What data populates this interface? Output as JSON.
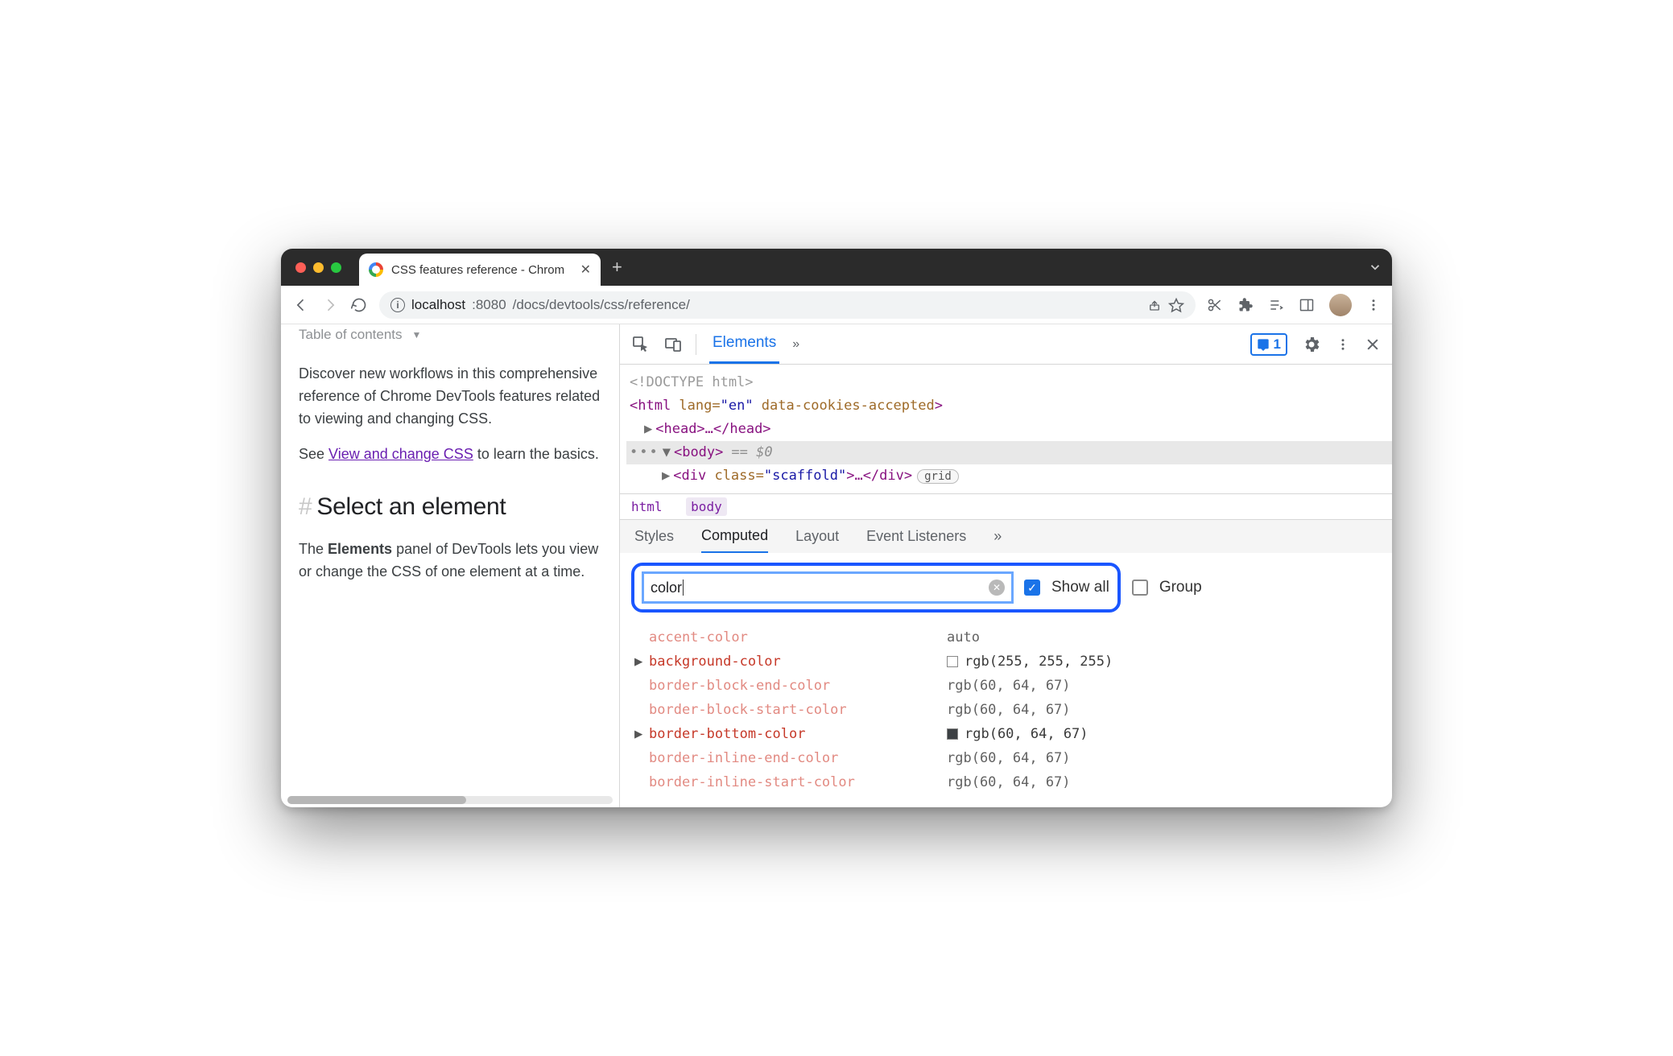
{
  "browser": {
    "tab_title": "CSS features reference - Chrom",
    "url_host": "localhost",
    "url_port": ":8080",
    "url_path": "/docs/devtools/css/reference/"
  },
  "page": {
    "toc_label": "Table of contents",
    "intro": "Discover new workflows in this comprehensive reference of Chrome DevTools features related to viewing and changing CSS.",
    "see_prefix": "See ",
    "see_link": "View and change CSS",
    "see_suffix": " to learn the basics.",
    "heading": "Select an element",
    "body_prefix": "The ",
    "body_bold": "Elements",
    "body_suffix": " panel of DevTools lets you view or change the CSS of one element at a time."
  },
  "devtools": {
    "panel_tab": "Elements",
    "issues_count": "1",
    "dom": {
      "doctype": "<!DOCTYPE html>",
      "html_open": "<html",
      "html_lang_attr": " lang=",
      "html_lang_val": "\"en\"",
      "html_cookies_attr": " data-cookies-accepted",
      "html_close": ">",
      "head": "<head>…</head>",
      "body_open": "<body>",
      "eq0": "== $0",
      "div_open": "<div ",
      "div_class_attr": "class=",
      "div_class_val": "\"scaffold\"",
      "div_close": ">…</div>",
      "grid_pill": "grid"
    },
    "crumbs": {
      "c1": "html",
      "c2": "body"
    },
    "styles_tabs": {
      "t1": "Styles",
      "t2": "Computed",
      "t3": "Layout",
      "t4": "Event Listeners"
    },
    "filter": {
      "value": "color",
      "show_all": "Show all",
      "group": "Group"
    },
    "computed": [
      {
        "prop": "accent-color",
        "val": "auto",
        "dim": true
      },
      {
        "prop": "background-color",
        "val": "rgb(255, 255, 255)",
        "expand": true,
        "swatch": "white"
      },
      {
        "prop": "border-block-end-color",
        "val": "rgb(60, 64, 67)",
        "dim": true
      },
      {
        "prop": "border-block-start-color",
        "val": "rgb(60, 64, 67)",
        "dim": true
      },
      {
        "prop": "border-bottom-color",
        "val": "rgb(60, 64, 67)",
        "expand": false,
        "swatch": "gray"
      },
      {
        "prop": "border-inline-end-color",
        "val": "rgb(60, 64, 67)",
        "dim": true
      },
      {
        "prop": "border-inline-start-color",
        "val": "rgb(60, 64, 67)",
        "dim": true
      }
    ]
  }
}
